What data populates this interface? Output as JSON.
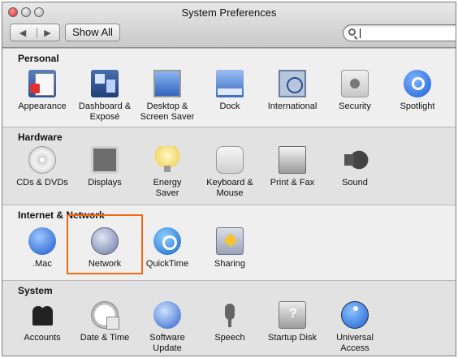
{
  "window": {
    "title": "System Preferences",
    "nav": {
      "back_label": "◀",
      "forward_label": "▶"
    },
    "show_all_label": "Show All",
    "search": {
      "value": ""
    }
  },
  "sections": [
    {
      "label": "Personal",
      "items": [
        {
          "label": "Appearance",
          "icon": "appearance-icon"
        },
        {
          "label": "Dashboard &\nExposé",
          "icon": "dashboard-icon"
        },
        {
          "label": "Desktop &\nScreen Saver",
          "icon": "desktop-icon"
        },
        {
          "label": "Dock",
          "icon": "dock-icon"
        },
        {
          "label": "International",
          "icon": "international-icon"
        },
        {
          "label": "Security",
          "icon": "security-icon"
        },
        {
          "label": "Spotlight",
          "icon": "spotlight-icon"
        }
      ]
    },
    {
      "label": "Hardware",
      "items": [
        {
          "label": "CDs & DVDs",
          "icon": "cd-icon"
        },
        {
          "label": "Displays",
          "icon": "display-icon"
        },
        {
          "label": "Energy\nSaver",
          "icon": "energy-icon"
        },
        {
          "label": "Keyboard &\nMouse",
          "icon": "keyboard-icon"
        },
        {
          "label": "Print & Fax",
          "icon": "printer-icon"
        },
        {
          "label": "Sound",
          "icon": "sound-icon"
        }
      ]
    },
    {
      "label": "Internet & Network",
      "items": [
        {
          "label": ".Mac",
          "icon": "dotmac-icon"
        },
        {
          "label": "Network",
          "icon": "network-icon"
        },
        {
          "label": "QuickTime",
          "icon": "quicktime-icon"
        },
        {
          "label": "Sharing",
          "icon": "sharing-icon"
        }
      ]
    },
    {
      "label": "System",
      "items": [
        {
          "label": "Accounts",
          "icon": "accounts-icon"
        },
        {
          "label": "Date & Time",
          "icon": "clock-icon"
        },
        {
          "label": "Software\nUpdate",
          "icon": "software-update-icon"
        },
        {
          "label": "Speech",
          "icon": "microphone-icon"
        },
        {
          "label": "Startup Disk",
          "icon": "disk-icon"
        },
        {
          "label": "Universal\nAccess",
          "icon": "accessibility-icon"
        }
      ]
    }
  ],
  "highlight_color": "#f06a14"
}
